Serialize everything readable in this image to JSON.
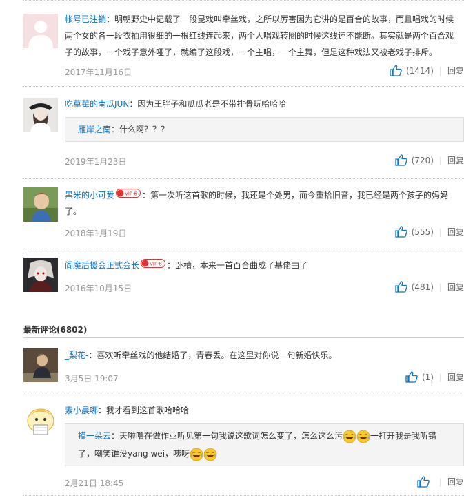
{
  "hot_comments": [
    {
      "user": "帐号已注销",
      "text": "明朝野史中记载了一段昆戏叫牵丝戏，之所以厉害因为它讲的是百合的故事，而且唱戏的时候两个女的各一段衣袖用很细的一根红线连起来，两个人唱戏转圈的时候这线还不能断。其实就是两个百合戏子的故事，一个戏子意外哑了，就编了这段戏，一个主唱，一个主舞，但是这种戏法又被老戏子排斥。",
      "date": "2017年11月16日",
      "likes": "(1414)",
      "reply_label": "回复"
    },
    {
      "user": "吃草莓的南瓜JUN",
      "text": "因为王胖子和瓜瓜老是不带排骨玩哈哈哈",
      "quote_user": "雁岸之南",
      "quote_text": "什么啊？？？",
      "date": "2019年1月23日",
      "likes": "(720)",
      "reply_label": "回复"
    },
    {
      "user": "黑米的小可爱",
      "vip": "VIP·6",
      "text": "第一次听这首歌的时候，我还是个处男，而今重拾旧音，我已经是两个孩子的妈妈了。",
      "date": "2018年1月19日",
      "likes": "(555)",
      "reply_label": "回复"
    },
    {
      "user": "阎魔后援会正式会长",
      "vip": "VIP·8",
      "text": "卧槽，本来一首百合曲成了基佬曲了",
      "date": "2016年10月15日",
      "likes": "(481)",
      "reply_label": "回复"
    }
  ],
  "latest_title": "最新评论(6802)",
  "latest_comments": [
    {
      "user": "_梨花-",
      "text": "喜欢听牵丝戏的他结婚了，青春丢。在这里对你说一句新婚快乐。",
      "date": "3月5日 19:07",
      "likes": "(1)",
      "reply_label": "回复"
    },
    {
      "user": "素小晨哪",
      "text": "我才看到这首歌哈哈哈",
      "quote_user": "摸一朵云",
      "quote_text_1": "天啦噜在做作业听见第一句我说这歌词怎么变了，怎么这么污",
      "quote_text_2": "一打开我是我听错了，嘲笑谁没yang wei，咦呀",
      "date": "2月21日 18:45",
      "likes": "",
      "reply_label": "回复"
    }
  ],
  "colors": {
    "link": "#0c73c2",
    "meta": "#999999",
    "quote_bg": "#f4f4f4"
  },
  "icons": [
    "thumb-up-icon",
    "laugh-cry-emoji"
  ]
}
